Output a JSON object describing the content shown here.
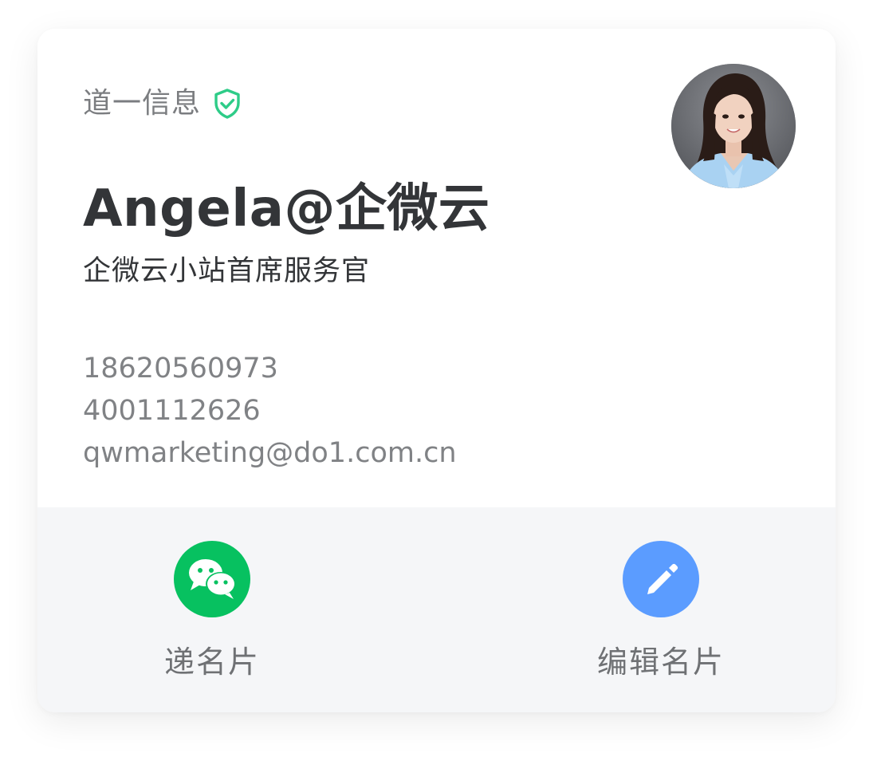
{
  "card": {
    "company": "道一信息",
    "name": "Angela@企微云",
    "title": "企微云小站首席服务官",
    "contacts": [
      "18620560973",
      "4001112626",
      "qwmarketing@do1.com.cn"
    ],
    "avatar": "profile-photo"
  },
  "actions": [
    {
      "label": "递名片",
      "icon": "wechat-icon",
      "color": "#07c160"
    },
    {
      "label": "编辑名片",
      "icon": "pencil-icon",
      "color": "#5b9cff"
    }
  ],
  "colors": {
    "verified": "#2ecc88",
    "wechat": "#07c160",
    "edit": "#5b9cff",
    "action_bar_bg": "#f5f6f8"
  }
}
